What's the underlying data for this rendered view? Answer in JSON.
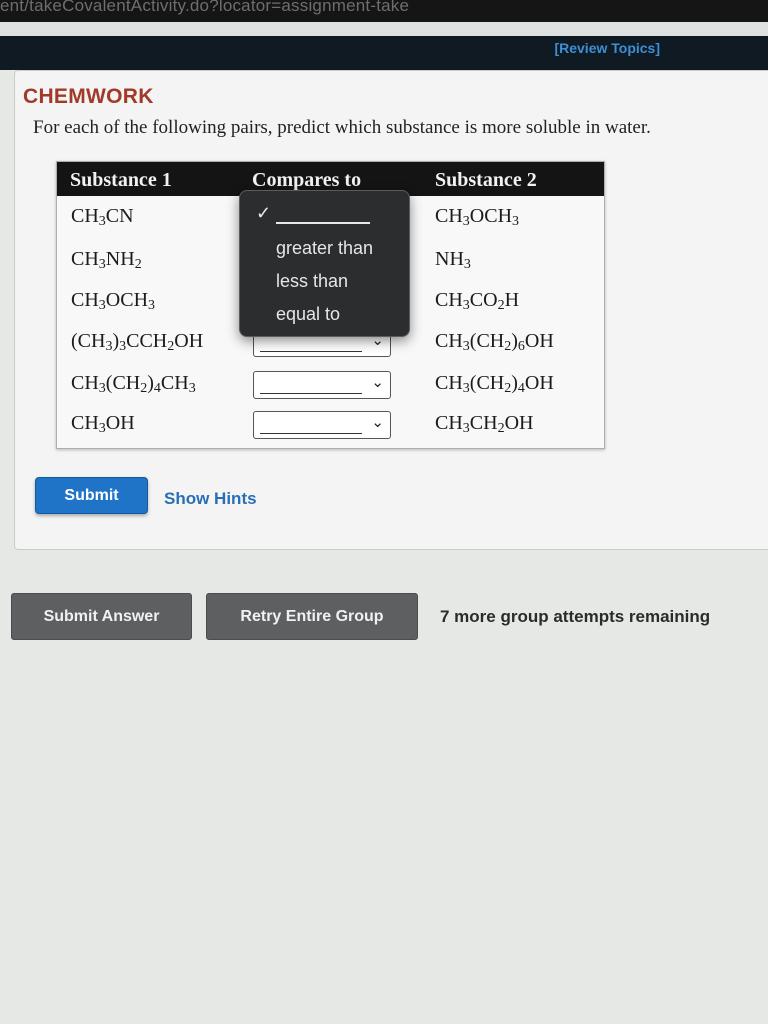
{
  "browser": {
    "url_fragment": "ent/takeCovalentActivity.do?locator=assignment-take"
  },
  "nav": {
    "review_topics": "[Review Topics]"
  },
  "question": {
    "title": "CHEMWORK",
    "instructions": "For each of the following pairs, predict which substance is more soluble in water.",
    "headers": {
      "substance1": "Substance 1",
      "compares": "Compares to",
      "substance2": "Substance 2"
    },
    "rows": [
      {
        "s1": [
          "CH",
          {
            "sub": "3"
          },
          "CN"
        ],
        "s2": [
          "CH",
          {
            "sub": "3"
          },
          "OCH",
          {
            "sub": "3"
          }
        ],
        "selected": ""
      },
      {
        "s1": [
          "CH",
          {
            "sub": "3"
          },
          "NH",
          {
            "sub": "2"
          }
        ],
        "s2": [
          "NH",
          {
            "sub": "3"
          }
        ],
        "selected": ""
      },
      {
        "s1": [
          "CH",
          {
            "sub": "3"
          },
          "OCH",
          {
            "sub": "3"
          }
        ],
        "s2": [
          "CH",
          {
            "sub": "3"
          },
          "CO",
          {
            "sub": "2"
          },
          "H"
        ],
        "selected": ""
      },
      {
        "s1": [
          "(CH",
          {
            "sub": "3"
          },
          ")",
          {
            "sub": "3"
          },
          "CCH",
          {
            "sub": "2"
          },
          "OH"
        ],
        "s2": [
          "CH",
          {
            "sub": "3"
          },
          "(CH",
          {
            "sub": "2"
          },
          ")",
          {
            "sub": "6"
          },
          "OH"
        ],
        "selected": ""
      },
      {
        "s1": [
          "CH",
          {
            "sub": "3"
          },
          "(CH",
          {
            "sub": "2"
          },
          ")",
          {
            "sub": "4"
          },
          "CH",
          {
            "sub": "3"
          }
        ],
        "s2": [
          "CH",
          {
            "sub": "3"
          },
          "(CH",
          {
            "sub": "2"
          },
          ")",
          {
            "sub": "4"
          },
          "OH"
        ],
        "selected": ""
      },
      {
        "s1": [
          "CH",
          {
            "sub": "3"
          },
          "OH"
        ],
        "s2": [
          "CH",
          {
            "sub": "3"
          },
          "CH",
          {
            "sub": "2"
          },
          "OH"
        ],
        "selected": ""
      }
    ],
    "dropdown_open": {
      "row": 0,
      "options": [
        "",
        "greater than",
        "less than",
        "equal to"
      ],
      "checked_index": 0
    },
    "submit_label": "Submit",
    "hints_label": "Show Hints"
  },
  "footer": {
    "submit_answer": "Submit Answer",
    "retry_group": "Retry Entire Group",
    "attempts_text": "7 more group attempts remaining"
  },
  "colors": {
    "title": "#a23a2a",
    "submit_button": "#1f74c8",
    "link": "#2a6fb5",
    "table_header": "#141414",
    "popup_bg": "#2b2d2e",
    "gray_button": "#5d5f60"
  }
}
